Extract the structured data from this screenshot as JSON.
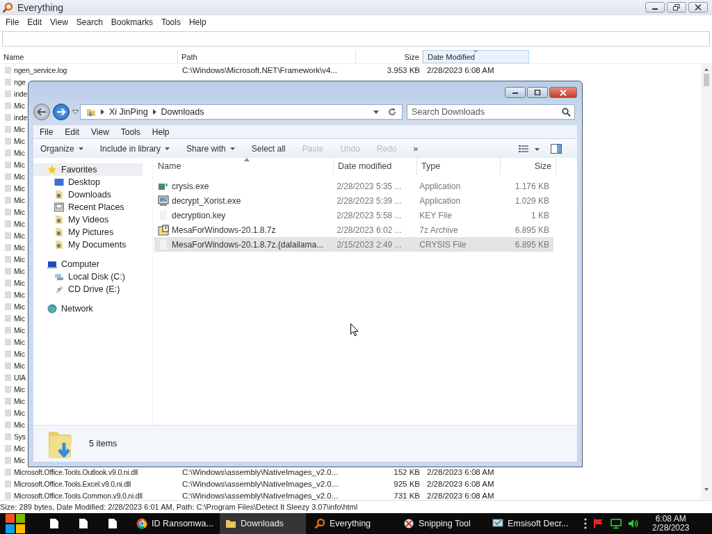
{
  "everything": {
    "title": "Everything",
    "menu": [
      "File",
      "Edit",
      "View",
      "Search",
      "Bookmarks",
      "Tools",
      "Help"
    ],
    "columns": [
      {
        "label": "Name",
        "sorted": false
      },
      {
        "label": "Path",
        "sorted": false
      },
      {
        "label": "Size",
        "sorted": false
      },
      {
        "label": "Date Modified",
        "sorted": true
      }
    ],
    "rows": [
      {
        "name": "ngen_service.log",
        "path": "C:\\Windows\\Microsoft.NET\\Framework\\v4...",
        "size": "3.953 KB",
        "date": "2/28/2023 6:08 AM"
      },
      {
        "name": "nge"
      },
      {
        "name": "inde"
      },
      {
        "name": "Mic"
      },
      {
        "name": "inde"
      },
      {
        "name": "Mic"
      },
      {
        "name": "Mic"
      },
      {
        "name": "Mic"
      },
      {
        "name": "Mic"
      },
      {
        "name": "Mic"
      },
      {
        "name": "Mic"
      },
      {
        "name": "Mic"
      },
      {
        "name": "Mic"
      },
      {
        "name": "Mic"
      },
      {
        "name": "Mic"
      },
      {
        "name": "Mic"
      },
      {
        "name": "Mic"
      },
      {
        "name": "Mic"
      },
      {
        "name": "Mic"
      },
      {
        "name": "Mic"
      },
      {
        "name": "Mic"
      },
      {
        "name": "Mic"
      },
      {
        "name": "Mic"
      },
      {
        "name": "Mic"
      },
      {
        "name": "Mic"
      },
      {
        "name": "Mic"
      },
      {
        "name": "UIA"
      },
      {
        "name": "Mic"
      },
      {
        "name": "Mic"
      },
      {
        "name": "Mic"
      },
      {
        "name": "Mic"
      },
      {
        "name": "Sys"
      },
      {
        "name": "Mic"
      },
      {
        "name": "Mic"
      },
      {
        "name": "Microsoft.Office.Tools.Outlook.v9.0.ni.dll",
        "path": "C:\\Windows\\assembly\\NativeImages_v2.0...",
        "size": "152 KB",
        "date": "2/28/2023 6:08 AM"
      },
      {
        "name": "Microsoft.Office.Tools.Excel.v9.0.ni.dll",
        "path": "C:\\Windows\\assembly\\NativeImages_v2.0...",
        "size": "925 KB",
        "date": "2/28/2023 6:08 AM"
      },
      {
        "name": "Microsoft.Office.Tools.Common.v9.0.ni.dll",
        "path": "C:\\Windows\\assembly\\NativeImages_v2.0...",
        "size": "731 KB",
        "date": "2/28/2023 6:08 AM"
      }
    ],
    "status_bar": "Size: 289 bytes, Date Modified: 2/28/2023 6:01 AM, Path: C:\\Program Files\\Detect It Sleezy 3.07\\info\\html"
  },
  "explorer": {
    "breadcrumb": [
      "Xi JinPing",
      "Downloads"
    ],
    "search": {
      "placeholder": "Search Downloads"
    },
    "menu": [
      "File",
      "Edit",
      "View",
      "Tools",
      "Help"
    ],
    "toolbar": [
      {
        "label": "Organize",
        "dropdown": true,
        "disabled": false
      },
      {
        "label": "Include in library",
        "dropdown": true,
        "disabled": false
      },
      {
        "label": "Share with",
        "dropdown": true,
        "disabled": false
      },
      {
        "label": "Select all",
        "dropdown": false,
        "disabled": false
      },
      {
        "label": "Paste",
        "dropdown": false,
        "disabled": true
      },
      {
        "label": "Undo",
        "dropdown": false,
        "disabled": true
      },
      {
        "label": "Redo",
        "dropdown": false,
        "disabled": true
      },
      {
        "label": "»",
        "dropdown": false,
        "disabled": false
      }
    ],
    "nav": [
      {
        "label": "Favorites",
        "kind": "star",
        "selected": true,
        "children": [
          {
            "label": "Desktop",
            "kind": "monitor"
          },
          {
            "label": "Downloads",
            "kind": "folder"
          },
          {
            "label": "Recent Places",
            "kind": "places"
          },
          {
            "label": "My Videos",
            "kind": "folder"
          },
          {
            "label": "My Pictures",
            "kind": "folder"
          },
          {
            "label": "My Documents",
            "kind": "folder"
          }
        ]
      },
      {
        "label": "Computer",
        "kind": "computer",
        "selected": false,
        "children": [
          {
            "label": "Local Disk (C:)",
            "kind": "drive"
          },
          {
            "label": "CD Drive (E:)",
            "kind": "cd"
          }
        ]
      },
      {
        "label": "Network",
        "kind": "globe",
        "selected": false
      }
    ],
    "columns": [
      {
        "label": "Name",
        "sorted": true
      },
      {
        "label": "Date modified",
        "sorted": false
      },
      {
        "label": "Type",
        "sorted": false
      },
      {
        "label": "Size",
        "sorted": false
      }
    ],
    "files": [
      {
        "name": "crysis.exe",
        "date": "2/28/2023 5:35 ...",
        "type": "Application",
        "size": "1.176 KB",
        "kind": "exe",
        "selected": false
      },
      {
        "name": "decrypt_Xorist.exe",
        "date": "2/28/2023 5:39 ...",
        "type": "Application",
        "size": "1.029 KB",
        "kind": "app",
        "selected": false
      },
      {
        "name": "decryption.key",
        "date": "2/28/2023 5:58 ...",
        "type": "KEY File",
        "size": "1 KB",
        "kind": "blank",
        "selected": false
      },
      {
        "name": "MesaForWindows-20.1.8.7z",
        "date": "2/28/2023 6:02 ...",
        "type": "7z Archive",
        "size": "6.895 KB",
        "kind": "archive",
        "selected": false
      },
      {
        "name": "MesaForWindows-20.1.8.7z.{dalailama...",
        "date": "2/15/2023 2:49 ...",
        "type": "CRYSIS File",
        "size": "6.895 KB",
        "kind": "blank",
        "selected": true
      }
    ],
    "details": "5 items"
  },
  "taskbar": {
    "buttons": [
      {
        "label": "ID Ransomwa...",
        "kind": "browser",
        "selected": false
      },
      {
        "label": "Downloads",
        "kind": "folder",
        "selected": true
      },
      {
        "label": "Everything",
        "kind": "search",
        "selected": false
      },
      {
        "label": "Snipping Tool",
        "kind": "snip",
        "selected": false
      },
      {
        "label": "Emsisoft Decr...",
        "kind": "app",
        "selected": false
      }
    ],
    "time": "6:08 AM",
    "date": "2/28/2023"
  }
}
